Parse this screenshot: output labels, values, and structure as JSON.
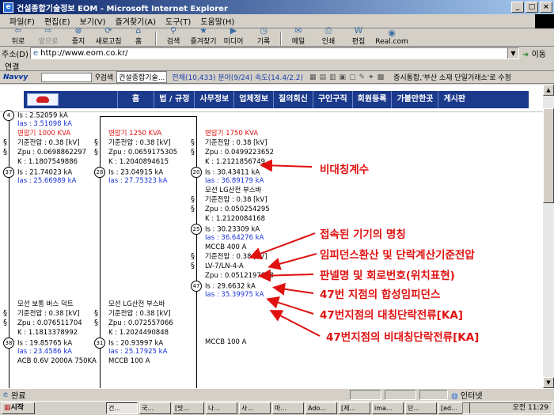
{
  "window": {
    "title": "건설종합기술정보 EOM - Microsoft Internet Explorer"
  },
  "menu": [
    "파일(F)",
    "편집(E)",
    "보기(V)",
    "즐겨찾기(A)",
    "도구(T)",
    "도움말(H)"
  ],
  "toolbar": {
    "back": "뒤로",
    "forward": "앞으로",
    "stop": "중지",
    "refresh": "새로고침",
    "home": "홈",
    "search": "검색",
    "favorites": "즐겨찾기",
    "media": "미디어",
    "history": "기록",
    "mail": "메일",
    "print": "인쇄",
    "edit": "편집",
    "real": "Real.com"
  },
  "address": {
    "label": "주소(D)",
    "url": "http://www.eom.co.kr/",
    "go": "이동"
  },
  "links": {
    "label": "연결"
  },
  "navvy": {
    "brand": "Navvy",
    "search": "검색",
    "site": "건설종합기술...",
    "stat": "전체(10,433) 분야(9/24) 속도(14.4/2.2)",
    "news": "증시통합,'부산 소재 단일거래소'로 수정"
  },
  "site_nav": [
    "홈",
    "법 / 규정",
    "사무정보",
    "업체정보",
    "질의회신",
    "구인구직",
    "회원등록",
    "가볼만한곳",
    "게시판"
  ],
  "diagram": {
    "col1": {
      "n4": "4",
      "is4": "Is : 2.52059 kA",
      "ias4": "Ias : 3.51098 kA",
      "tr": "변압기 1000 KVA",
      "v": "기준전압 : 0.38 [kV]",
      "z": "Zpu : 0.0698862297",
      "k": "K : 1.1807549886",
      "n37": "37",
      "is37": "Is : 21.74023 kA",
      "ias37": "Ias : 25.66989 kA",
      "bus": "모선 보통 버스 덕트",
      "v2": "기준전압 : 0.38 [kV]",
      "z2": "Zpu : 0.076511704",
      "k2": "K : 1.1813378992",
      "n38": "38",
      "is38": "Is : 19.85765 kA",
      "ias38": "Ias : 23.4586 kA",
      "acb": "ACB 0.6V 2000A 750KA"
    },
    "col2": {
      "tr": "변압기 1250 KVA",
      "v": "기준전압 : 0.38 [kV]",
      "z": "Zpu : 0.0659175305",
      "k": "K : 1.2040894615",
      "n28": "28",
      "is28": "Is : 23.04915 kA",
      "ias28": "Ias : 27.75323 kA",
      "bus": "모선 LG산전 부스바",
      "v2": "기준전압 : 0.38 [kV]",
      "z2": "Zpu : 0.072557066",
      "k2": "K : 1.2024490848",
      "n31": "31",
      "is31": "Is : 20.93997 kA",
      "ias31": "Ias : 25.17925 kA",
      "mccb": "MCCB 100 A"
    },
    "col3": {
      "tr": "변압기 1750 KVA",
      "v": "기준전압 : 0.38 [kV]",
      "z": "Zpu : 0.0499223652",
      "k": "K : 1.2121856749",
      "n20": "20",
      "is20": "Is : 30.43411 kA",
      "ias20": "Ias : 36.89179 kA",
      "bus": "모선 LG산전 부스바",
      "v2": "기준전압 : 0.38 [kV]",
      "z2": "Zpu : 0.050254295",
      "k2": "K : 1.2120084168",
      "n25": "25",
      "is25": "Is : 30.23309 kA",
      "ias25": "Ias : 36.64276 kA",
      "mccb": "MCCB 400 A",
      "v3": "기준전압 : 0.38 [kV]",
      "lv": "LV-7/LN-4-A",
      "z3": "Zpu : 0.0512197888",
      "n47": "47",
      "is47": "Is : 29.6632 kA",
      "ias47": "Ias : 35.39975 kA",
      "mccb2": "MCCB 100 A"
    }
  },
  "annotations": {
    "a1": "비대칭계수",
    "a2": "접속된 기기의 명칭",
    "a3": "임피던스환산 및 단락계산기준전압",
    "a4": "판넬명 및 회로번호(위치표현)",
    "a5": "47번 지점의 합성임피던스",
    "a6": "47번지점의 대칭단락전류[KA]",
    "a7": "47번지점의 비대칭단락전류[KA]"
  },
  "status": {
    "text": "완료",
    "zone": "인터넷"
  },
  "taskbar": {
    "start": "시작",
    "tasks": [
      "건...",
      "국...",
      "[맛...",
      "나...",
      "사...",
      "마...",
      "Ado...",
      "[제...",
      "ima...",
      "단...",
      "[ed..."
    ],
    "clock": "오전 11:29"
  },
  "colors": {
    "nav": "#1c3a8c",
    "annotation": "#e01010",
    "asym_current": "#1a34d8"
  }
}
